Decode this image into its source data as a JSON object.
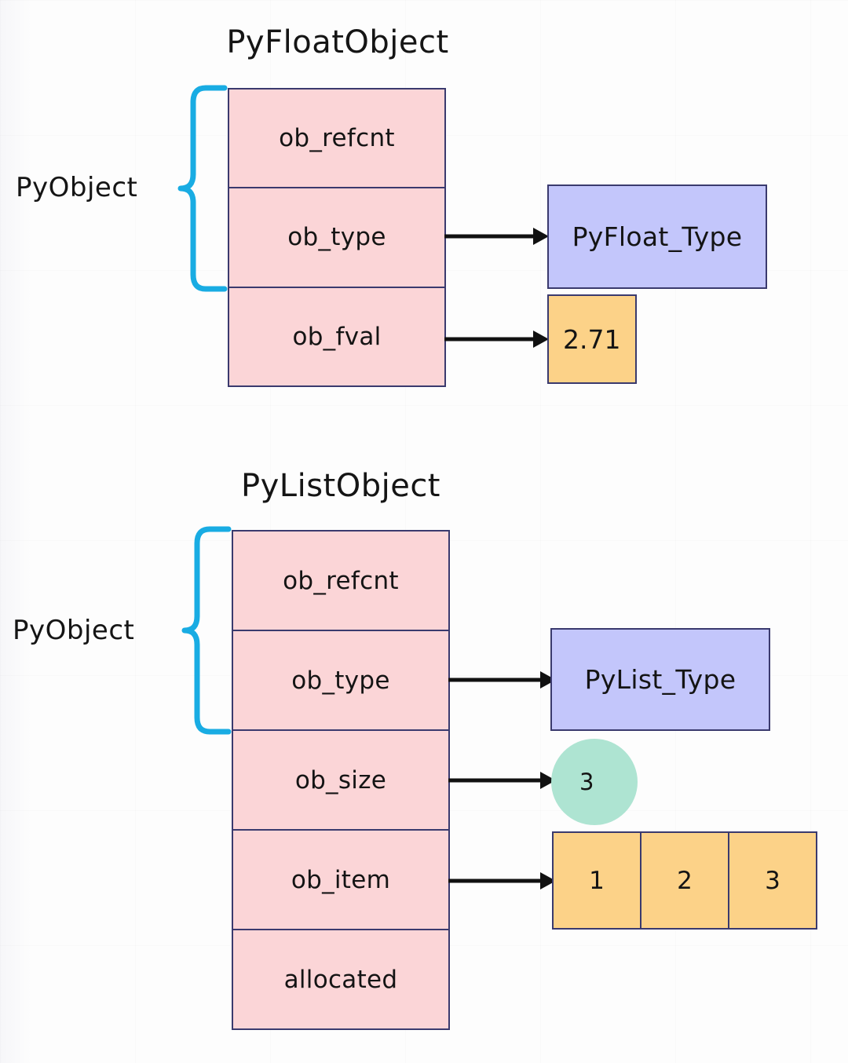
{
  "colors": {
    "struct_fill": "#fbd5d7",
    "struct_border": "#3a3a6e",
    "type_fill": "#c3c6fb",
    "value_fill": "#fcd288",
    "circle_fill": "#aee4d2",
    "brace": "#19ace3",
    "arrow": "#111111",
    "background": "#fdfdfd",
    "text": "#141414"
  },
  "diagram": {
    "float_section": {
      "title": "PyFloatObject",
      "group_label": "PyObject",
      "brace_icon": "curly-brace-icon",
      "fields": [
        {
          "name": "ob_refcnt",
          "has_arrow": false
        },
        {
          "name": "ob_type",
          "has_arrow": true
        },
        {
          "name": "ob_fval",
          "has_arrow": true
        }
      ],
      "type_box": "PyFloat_Type",
      "value_box": "2.71"
    },
    "list_section": {
      "title": "PyListObject",
      "group_label": "PyObject",
      "brace_icon": "curly-brace-icon",
      "fields": [
        {
          "name": "ob_refcnt",
          "has_arrow": false
        },
        {
          "name": "ob_type",
          "has_arrow": true
        },
        {
          "name": "ob_size",
          "has_arrow": true
        },
        {
          "name": "ob_item",
          "has_arrow": true
        },
        {
          "name": "allocated",
          "has_arrow": false
        }
      ],
      "type_box": "PyList_Type",
      "size_circle": "3",
      "items": [
        "1",
        "2",
        "3"
      ]
    }
  }
}
